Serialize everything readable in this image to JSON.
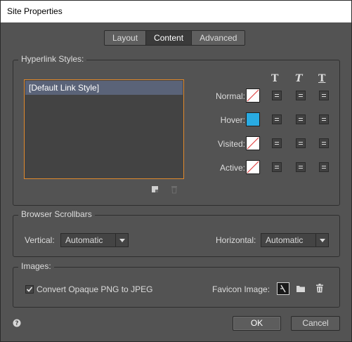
{
  "window": {
    "title": "Site Properties"
  },
  "tabs": [
    {
      "label": "Layout",
      "active": false
    },
    {
      "label": "Content",
      "active": true
    },
    {
      "label": "Advanced",
      "active": false
    }
  ],
  "hyperlink": {
    "title": "Hyperlink Styles:",
    "list_items": [
      "[Default Link Style]"
    ],
    "rows": [
      {
        "label": "Normal:",
        "swatch": "none"
      },
      {
        "label": "Hover:",
        "swatch": "#29abe2"
      },
      {
        "label": "Visited:",
        "swatch": "none"
      },
      {
        "label": "Active:",
        "swatch": "none"
      }
    ],
    "header_icons": [
      "bold-text-icon",
      "italic-text-icon",
      "underline-text-icon"
    ],
    "header_glyph": "T",
    "action_icons": [
      "new-style-icon",
      "delete-style-icon"
    ]
  },
  "scrollbars": {
    "title": "Browser Scrollbars",
    "vertical_label": "Vertical:",
    "vertical_value": "Automatic",
    "horizontal_label": "Horizontal:",
    "horizontal_value": "Automatic"
  },
  "images": {
    "title": "Images:",
    "convert_label": "Convert Opaque PNG to JPEG",
    "convert_checked": true,
    "favicon_label": "Favicon Image:",
    "favicon_icons": [
      "favicon-preview-icon",
      "folder-icon",
      "trash-icon"
    ]
  },
  "footer": {
    "help_icon": "help-icon",
    "ok_label": "OK",
    "cancel_label": "Cancel"
  },
  "colors": {
    "accent_focus": "#e0892c",
    "hover_swatch": "#29abe2",
    "background": "#535353"
  }
}
